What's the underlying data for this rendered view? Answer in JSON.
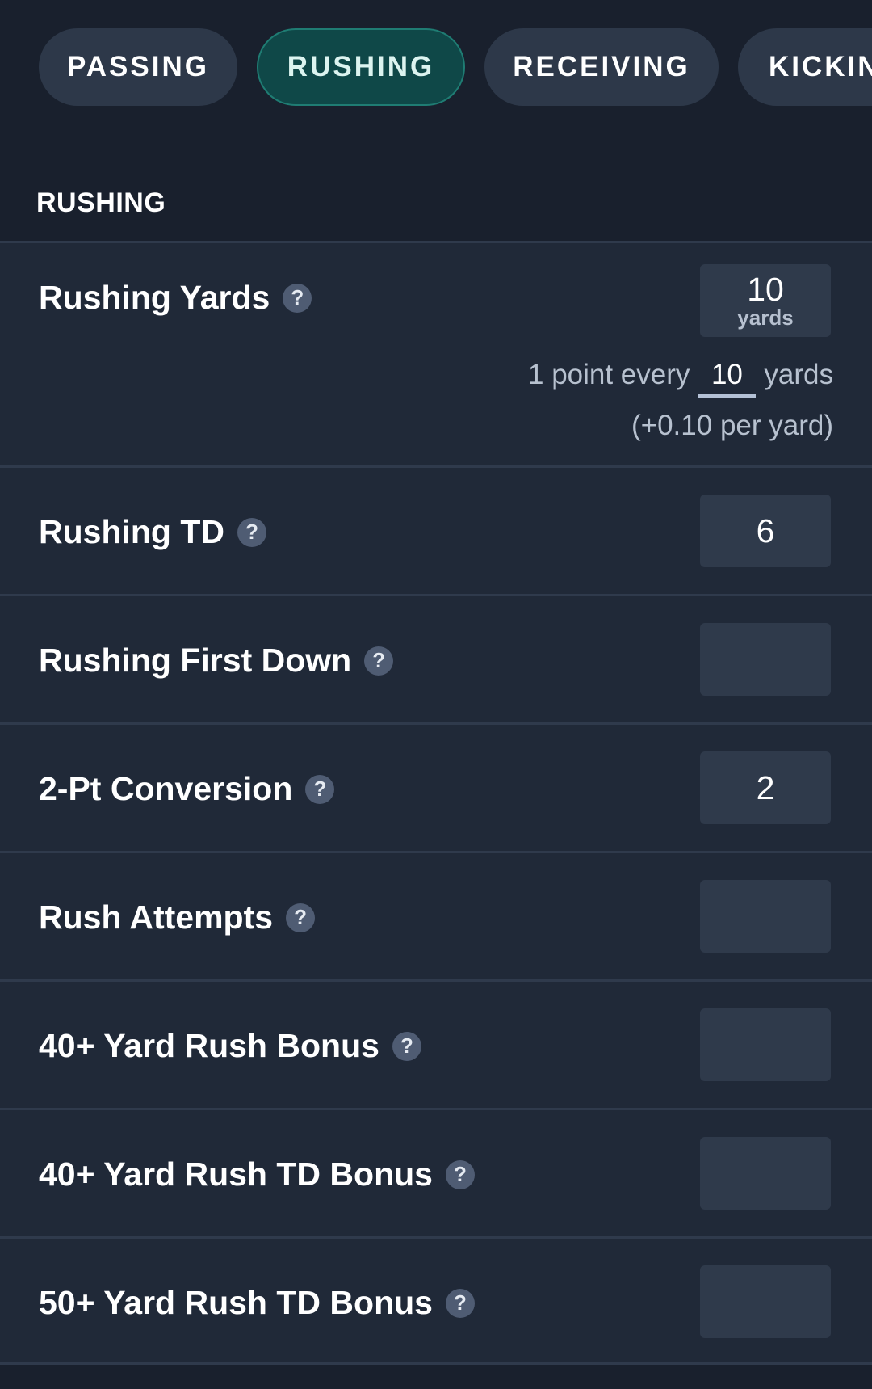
{
  "tabs": [
    {
      "label": "PASSING",
      "active": false
    },
    {
      "label": "RUSHING",
      "active": true
    },
    {
      "label": "RECEIVING",
      "active": false
    },
    {
      "label": "KICKIN",
      "active": false
    }
  ],
  "section": {
    "title": "RUSHING"
  },
  "rows": [
    {
      "label": "Rushing Yards",
      "value": "10",
      "unit": "yards",
      "rate": {
        "prefix": "1 point every",
        "value": "10",
        "suffix": "yards",
        "note": "(+0.10 per yard)"
      }
    },
    {
      "label": "Rushing TD",
      "value": "6"
    },
    {
      "label": "Rushing First Down",
      "value": ""
    },
    {
      "label": "2-Pt Conversion",
      "value": "2"
    },
    {
      "label": "Rush Attempts",
      "value": ""
    },
    {
      "label": "40+ Yard Rush Bonus",
      "value": ""
    },
    {
      "label": "40+ Yard Rush TD Bonus",
      "value": ""
    },
    {
      "label": "50+ Yard Rush TD Bonus",
      "value": ""
    }
  ],
  "icons": {
    "help": "question-mark-icon",
    "help_glyph": "?"
  },
  "colors": {
    "background": "#19202d",
    "row_background": "#202938",
    "tab_background": "#2d3849",
    "tab_active_background": "#0f4848",
    "tab_active_border": "#1f7c73",
    "input_background": "#2f3a4b",
    "help_icon_background": "#4f5c73"
  }
}
